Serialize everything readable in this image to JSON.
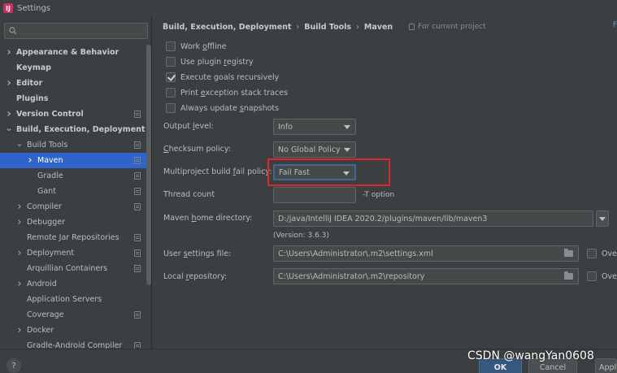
{
  "window": {
    "title": "Settings"
  },
  "sidebar": {
    "search_placeholder": "",
    "items": [
      {
        "label": "Appearance & Behavior",
        "arrow": ">",
        "level": 0,
        "bold": true,
        "proj": false
      },
      {
        "label": "Keymap",
        "arrow": "",
        "level": 0,
        "bold": true,
        "proj": false
      },
      {
        "label": "Editor",
        "arrow": ">",
        "level": 0,
        "bold": true,
        "proj": false
      },
      {
        "label": "Plugins",
        "arrow": "",
        "level": 0,
        "bold": true,
        "proj": false
      },
      {
        "label": "Version Control",
        "arrow": ">",
        "level": 0,
        "bold": true,
        "proj": true
      },
      {
        "label": "Build, Execution, Deployment",
        "arrow": "v",
        "level": 0,
        "bold": true,
        "proj": false
      },
      {
        "label": "Build Tools",
        "arrow": "v",
        "level": 1,
        "bold": false,
        "proj": true
      },
      {
        "label": "Maven",
        "arrow": ">",
        "level": 2,
        "bold": false,
        "proj": true,
        "selected": true
      },
      {
        "label": "Gradle",
        "arrow": "",
        "level": 2,
        "bold": false,
        "proj": true
      },
      {
        "label": "Gant",
        "arrow": "",
        "level": 2,
        "bold": false,
        "proj": true
      },
      {
        "label": "Compiler",
        "arrow": ">",
        "level": 1,
        "bold": false,
        "proj": true
      },
      {
        "label": "Debugger",
        "arrow": ">",
        "level": 1,
        "bold": false,
        "proj": false
      },
      {
        "label": "Remote Jar Repositories",
        "arrow": "",
        "level": 1,
        "bold": false,
        "proj": true
      },
      {
        "label": "Deployment",
        "arrow": ">",
        "level": 1,
        "bold": false,
        "proj": true
      },
      {
        "label": "Arquillian Containers",
        "arrow": "",
        "level": 1,
        "bold": false,
        "proj": true
      },
      {
        "label": "Android",
        "arrow": ">",
        "level": 1,
        "bold": false,
        "proj": false
      },
      {
        "label": "Application Servers",
        "arrow": "",
        "level": 1,
        "bold": false,
        "proj": false
      },
      {
        "label": "Coverage",
        "arrow": "",
        "level": 1,
        "bold": false,
        "proj": true
      },
      {
        "label": "Docker",
        "arrow": ">",
        "level": 1,
        "bold": false,
        "proj": false
      },
      {
        "label": "Gradle-Android Compiler",
        "arrow": "",
        "level": 1,
        "bold": false,
        "proj": true
      }
    ]
  },
  "breadcrumb": {
    "part1": "Build, Execution, Deployment",
    "part2": "Build Tools",
    "part3": "Maven",
    "for_project": "For current project",
    "corner": "F"
  },
  "checkboxes": {
    "work_offline": {
      "pre": "Work ",
      "ul": "o",
      "post": "ffline",
      "checked": false
    },
    "plugin_registry": {
      "pre": "Use plugin ",
      "ul": "r",
      "post": "egistry",
      "checked": false
    },
    "execute_goals": {
      "pre": "Execute ",
      "ul": "g",
      "post": "oals recursively",
      "checked": true
    },
    "print_exception": {
      "pre": "Print ",
      "ul": "e",
      "post": "xception stack traces",
      "checked": false
    },
    "always_update": {
      "pre": "Always update ",
      "ul": "s",
      "post": "napshots",
      "checked": false
    }
  },
  "fields": {
    "output_level": {
      "pre": "Output ",
      "ul": "l",
      "post": "evel:",
      "value": "Info"
    },
    "checksum_policy": {
      "pre": "",
      "ul": "C",
      "post": "hecksum policy:",
      "value": "No Global Policy"
    },
    "multiproject_policy": {
      "pre": "Multiproject build ",
      "ul": "f",
      "post": "ail policy:",
      "value": "Fail Fast"
    },
    "thread_count": {
      "label": "Thread count",
      "value": "",
      "hint": "-T option"
    },
    "maven_home": {
      "pre": "Maven ",
      "ul": "h",
      "post": "ome directory:",
      "value": "D:/java/IntelliJ IDEA 2020.2/plugins/maven/lib/maven3",
      "version": "(Version: 3.6.3)"
    },
    "user_settings": {
      "pre": "User ",
      "ul": "s",
      "post": "ettings file:",
      "value": "C:\\Users\\Administrator\\.m2\\settings.xml",
      "override": "Over"
    },
    "local_repo": {
      "pre": "Local ",
      "ul": "r",
      "post": "epository:",
      "value": "C:\\Users\\Administrator\\.m2\\repository",
      "override": "Over"
    }
  },
  "buttons": {
    "help": "?",
    "ok": "OK",
    "cancel": "Cancel",
    "apply": "Apply"
  },
  "watermark": "CSDN @wangYan0608",
  "colors": {
    "selection": "#2f65ca",
    "highlight": "#e0262b",
    "background": "#3c3f41",
    "ok_button": "#365880"
  }
}
